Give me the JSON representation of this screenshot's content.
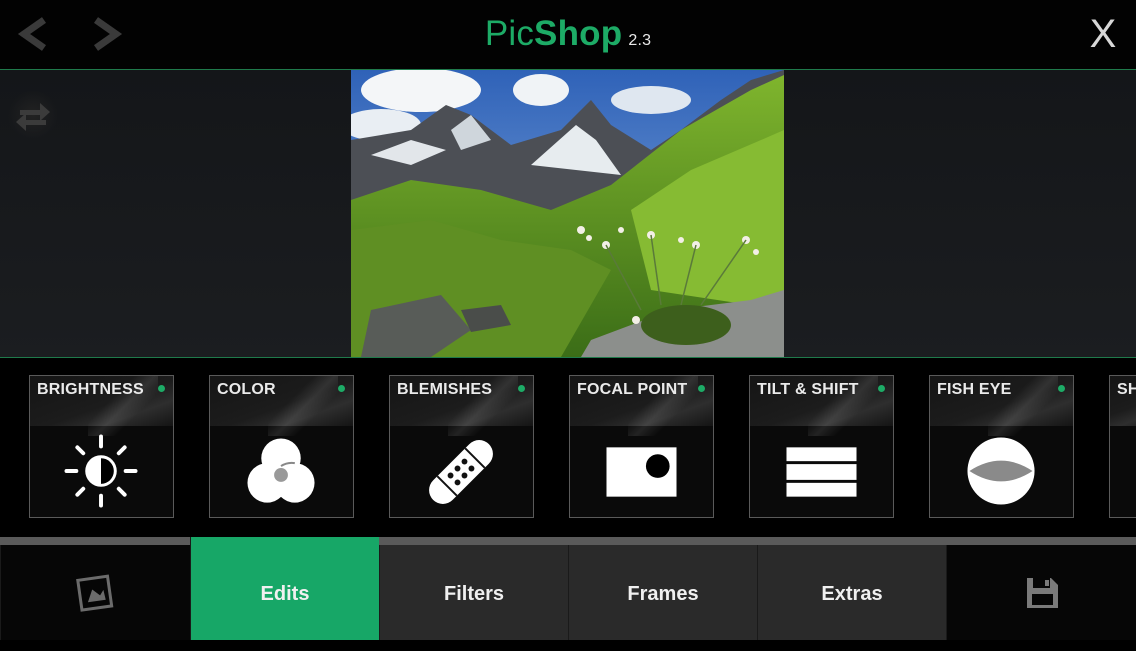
{
  "header": {
    "title_part1": "Pic",
    "title_part2": "Shop",
    "version": "2.3",
    "close_label": "X",
    "back_icon": "chevron-left-icon",
    "forward_icon": "chevron-right-icon"
  },
  "preview": {
    "swap_icon": "swap-arrows-icon",
    "photo_subject": "mountain-landscape-photo"
  },
  "tools": [
    {
      "label": "BRIGHTNESS",
      "icon": "brightness-icon"
    },
    {
      "label": "COLOR",
      "icon": "color-circles-icon"
    },
    {
      "label": "BLEMISHES",
      "icon": "bandage-icon"
    },
    {
      "label": "FOCAL POINT",
      "icon": "focal-point-icon"
    },
    {
      "label": "TILT & SHIFT",
      "icon": "tilt-shift-icon"
    },
    {
      "label": "FISH EYE",
      "icon": "fish-eye-icon"
    },
    {
      "label": "SH",
      "icon": ""
    }
  ],
  "tabs": {
    "gallery_icon": "photo-gallery-icon",
    "edits": "Edits",
    "filters": "Filters",
    "frames": "Frames",
    "extras": "Extras",
    "save_icon": "floppy-disk-icon",
    "active": "Edits"
  },
  "colors": {
    "accent": "#17a767",
    "title_green": "#1dab66",
    "tab_bg": "#2a2a2a"
  }
}
